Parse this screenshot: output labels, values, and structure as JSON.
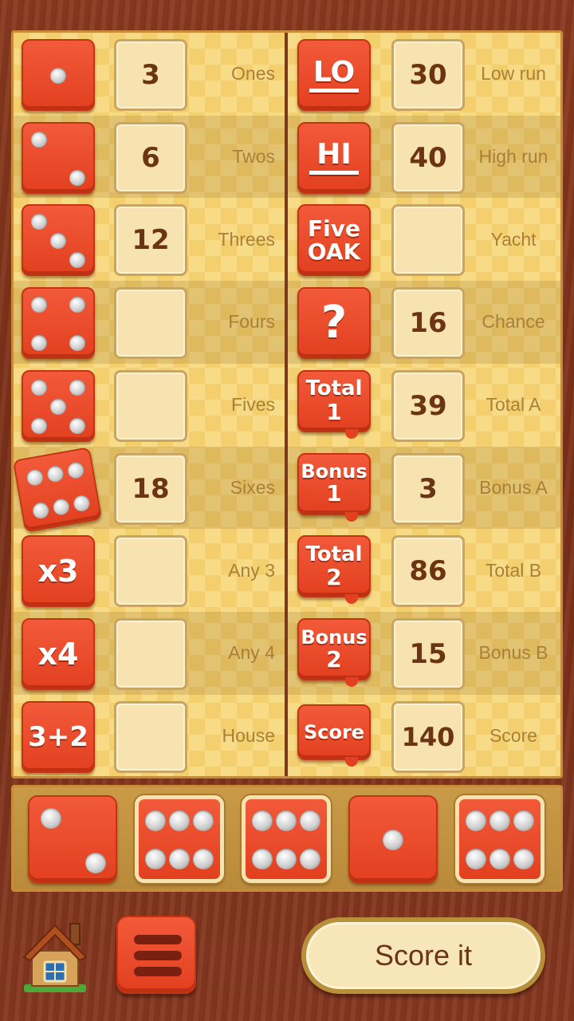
{
  "left_rows": [
    {
      "icon": "die-1",
      "score": "3",
      "label": "Ones"
    },
    {
      "icon": "die-2",
      "score": "6",
      "label": "Twos"
    },
    {
      "icon": "die-3",
      "score": "12",
      "label": "Threes"
    },
    {
      "icon": "die-4",
      "score": "",
      "label": "Fours"
    },
    {
      "icon": "die-5",
      "score": "",
      "label": "Fives"
    },
    {
      "icon": "die-6",
      "score": "18",
      "label": "Sixes"
    },
    {
      "icon": "text",
      "icon_text": "x3",
      "score": "",
      "label": "Any 3"
    },
    {
      "icon": "text",
      "icon_text": "x4",
      "score": "",
      "label": "Any 4"
    },
    {
      "icon": "text",
      "icon_text": "3+2",
      "score": "",
      "label": "House"
    }
  ],
  "right_rows": [
    {
      "icon_text": "LO",
      "score": "30",
      "label": "Low run"
    },
    {
      "icon_text": "HI",
      "score": "40",
      "label": "High run"
    },
    {
      "icon_line1": "Five",
      "icon_line2": "OAK",
      "score": "",
      "label": "Yacht"
    },
    {
      "icon_text": "?",
      "score": "16",
      "label": "Chance"
    },
    {
      "icon_line1": "Total",
      "icon_line2": "1",
      "score": "39",
      "label": "Total A"
    },
    {
      "icon_line1": "Bonus",
      "icon_line2": "1",
      "score": "3",
      "label": "Bonus A"
    },
    {
      "icon_line1": "Total",
      "icon_line2": "2",
      "score": "86",
      "label": "Total B"
    },
    {
      "icon_line1": "Bonus",
      "icon_line2": "2",
      "score": "15",
      "label": "Bonus B"
    },
    {
      "icon_line1": "Score",
      "icon_line2": "",
      "score": "140",
      "label": "Score"
    }
  ],
  "dice": [
    {
      "value": 2,
      "held": false
    },
    {
      "value": 6,
      "held": true
    },
    {
      "value": 6,
      "held": true
    },
    {
      "value": 1,
      "held": false
    },
    {
      "value": 6,
      "held": true
    }
  ],
  "buttons": {
    "score_it": "Score it"
  },
  "colors": {
    "tile_red": "#e2401f",
    "board_yellow": "#f3cf6e",
    "score_text": "#6b3414",
    "wood": "#7a3018"
  }
}
